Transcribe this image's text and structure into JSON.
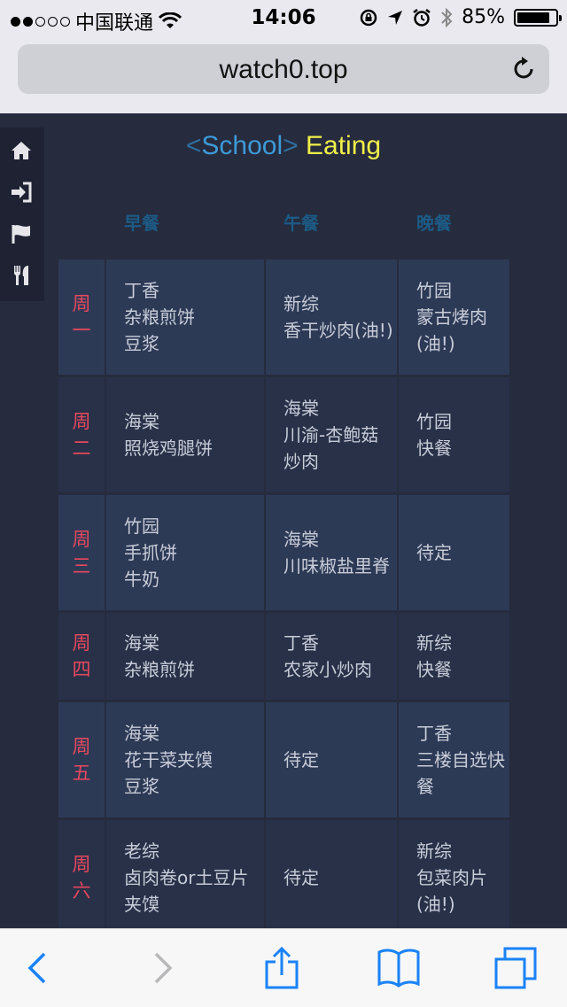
{
  "status": {
    "carrier": "中国联通",
    "time": "14:06",
    "battery_text": "85%",
    "battery_level": 0.85,
    "signal_bars_filled": 2,
    "signal_bars_total": 5
  },
  "browser": {
    "url": "watch0.top"
  },
  "brand": {
    "open": "<",
    "school": "School",
    "close": ">",
    "eating": "Eating"
  },
  "columns": {
    "breakfast": "早餐",
    "lunch": "午餐",
    "dinner": "晚餐"
  },
  "rows": [
    {
      "day": [
        "周",
        "一"
      ],
      "breakfast": [
        "丁香",
        "杂粮煎饼",
        "豆浆"
      ],
      "lunch": [
        "新综",
        "香干炒肉(油!)"
      ],
      "dinner": [
        "竹园",
        "蒙古烤肉",
        "(油!)"
      ]
    },
    {
      "day": [
        "周",
        "二"
      ],
      "breakfast": [
        "海棠",
        "照烧鸡腿饼"
      ],
      "lunch": [
        "海棠",
        "川渝-杏鲍菇",
        "炒肉"
      ],
      "dinner": [
        "竹园",
        "快餐"
      ]
    },
    {
      "day": [
        "周",
        "三"
      ],
      "breakfast": [
        "竹园",
        "手抓饼",
        "牛奶"
      ],
      "lunch": [
        "海棠",
        "川味椒盐里脊"
      ],
      "dinner": [
        "待定"
      ]
    },
    {
      "day": [
        "周",
        "四"
      ],
      "breakfast": [
        "海棠",
        "杂粮煎饼"
      ],
      "lunch": [
        "丁香",
        "农家小炒肉"
      ],
      "dinner": [
        "新综",
        "快餐"
      ]
    },
    {
      "day": [
        "周",
        "五"
      ],
      "breakfast": [
        "海棠",
        "花干菜夹馍",
        "豆浆"
      ],
      "lunch": [
        "待定"
      ],
      "dinner": [
        "丁香",
        "三楼自选快",
        "餐"
      ]
    },
    {
      "day": [
        "周",
        "六"
      ],
      "breakfast": [
        "老综",
        "卤肉卷or土豆片",
        "夹馍"
      ],
      "lunch": [
        "待定"
      ],
      "dinner": [
        "新综",
        "包菜肉片",
        "(油!)"
      ]
    }
  ],
  "icons": {
    "nav": [
      "home-icon",
      "sign-in-icon",
      "flag-icon",
      "cutlery-icon"
    ],
    "toolbar": [
      "back-icon",
      "forward-icon",
      "share-icon",
      "bookmarks-icon",
      "tabs-icon"
    ]
  },
  "colors": {
    "background": "#262b3d",
    "cell": "#2d3a56",
    "day_text": "#e8485e",
    "header_text": "#1c5b86",
    "school": "#3d9ad8",
    "eating": "#f0f04a",
    "ios_blue": "#1a82f7"
  }
}
